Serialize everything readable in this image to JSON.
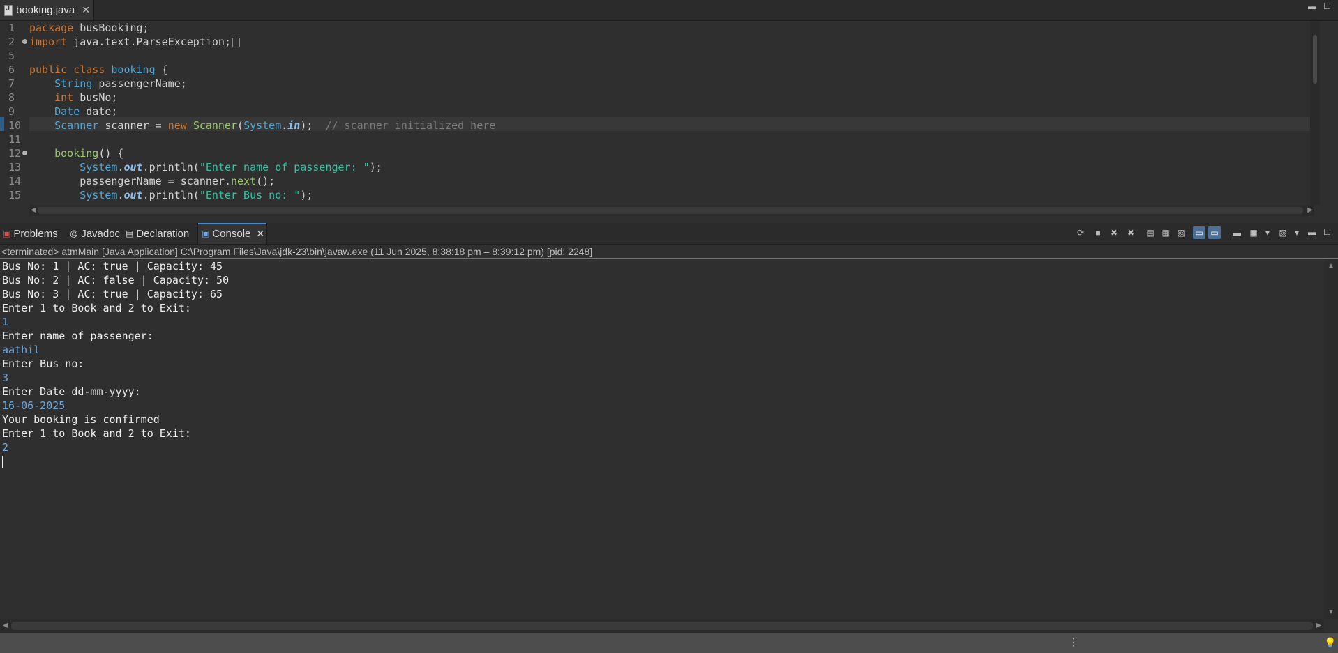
{
  "editor": {
    "tab_label": "booking.java",
    "tab_close": "✕",
    "lines": [
      {
        "no": "1"
      },
      {
        "no": "2"
      },
      {
        "no": "5"
      },
      {
        "no": "6"
      },
      {
        "no": "7"
      },
      {
        "no": "8"
      },
      {
        "no": "9"
      },
      {
        "no": "10"
      },
      {
        "no": "11"
      },
      {
        "no": "12"
      },
      {
        "no": "13"
      },
      {
        "no": "14"
      },
      {
        "no": "15"
      }
    ],
    "code": {
      "l1_kw": "package",
      "l1_rest": " busBooking;",
      "l2_kw": "import",
      "l2_rest": " java.text.ParseException;",
      "l6_kw": "public class",
      "l6_name": "booking",
      "l6_rest": " {",
      "l7_type": "String",
      "l7_rest": " passengerName;",
      "l8_type": "int",
      "l8_rest": " busNo;",
      "l9_type": "Date",
      "l9_rest": " date;",
      "l10_type": "Scanner",
      "l10_a": " scanner = ",
      "l10_new": "new",
      "l10_sc": "Scanner",
      "l10_p": "(",
      "l10_sys": "System",
      "l10_dot": ".",
      "l10_in": "in",
      "l10_end": ");  ",
      "l10_cm": "// scanner initialized here",
      "l12_fn": "booking",
      "l12_rest": "() {",
      "l13_sys": "System",
      "l13_dot": ".",
      "l13_out": "out",
      "l13_m": ".println(",
      "l13_str": "\"Enter name of passenger: \"",
      "l13_end": ");",
      "l14_a": "passengerName = scanner.",
      "l14_fn": "next",
      "l14_end": "();",
      "l15_sys": "System",
      "l15_dot": ".",
      "l15_out": "out",
      "l15_m": ".println(",
      "l15_str": "\"Enter Bus no: \"",
      "l15_end": ");"
    }
  },
  "views": {
    "tabs": [
      {
        "label": "Problems",
        "icon": "problems-icon"
      },
      {
        "label": "Javadoc",
        "icon": "javadoc-icon"
      },
      {
        "label": "Declaration",
        "icon": "declaration-icon"
      },
      {
        "label": "Console",
        "icon": "console-icon",
        "active": true
      }
    ],
    "console_close": "✕"
  },
  "console": {
    "status": "<terminated> atmMain [Java Application] C:\\Program Files\\Java\\jdk-23\\bin\\javaw.exe  (11 Jun 2025, 8:38:18 pm – 8:39:12 pm) [pid: 2248]",
    "output": [
      {
        "text": "Bus No: 1 | AC: true | Capacity: 45",
        "kind": "sys"
      },
      {
        "text": "Bus No: 2 | AC: false | Capacity: 50",
        "kind": "sys"
      },
      {
        "text": "Bus No: 3 | AC: true | Capacity: 65",
        "kind": "sys"
      },
      {
        "text": "Enter 1 to Book and 2 to Exit:",
        "kind": "sys"
      },
      {
        "text": "1",
        "kind": "user"
      },
      {
        "text": "Enter name of passenger:",
        "kind": "sys"
      },
      {
        "text": "aathil",
        "kind": "user"
      },
      {
        "text": "Enter Bus no:",
        "kind": "sys"
      },
      {
        "text": "3",
        "kind": "user"
      },
      {
        "text": "Enter Date dd-mm-yyyy:",
        "kind": "sys"
      },
      {
        "text": "16-06-2025",
        "kind": "user"
      },
      {
        "text": "Your booking is confirmed",
        "kind": "sys"
      },
      {
        "text": "Enter 1 to Book and 2 to Exit:",
        "kind": "sys"
      },
      {
        "text": "2",
        "kind": "user"
      }
    ]
  },
  "colors": {
    "user_input": "#6fa8dc",
    "keyword": "#cc7832",
    "type": "#4fa7d7",
    "string": "#2fc4a4",
    "active_tab_accent": "#3a8dde"
  }
}
